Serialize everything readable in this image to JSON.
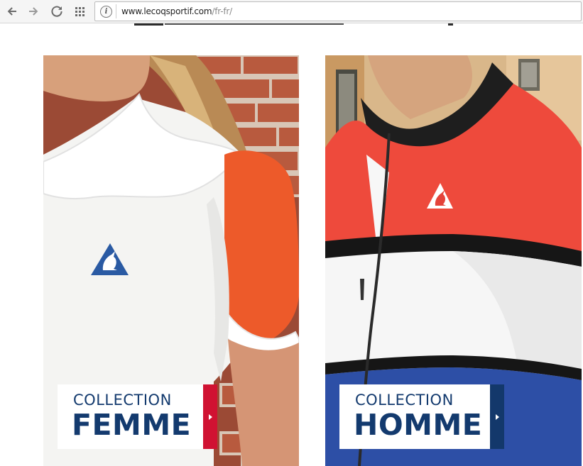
{
  "browser": {
    "url_host": "www.lecoqsportif.com",
    "url_path": "/fr-fr/"
  },
  "collections": [
    {
      "small": "COLLECTION",
      "big": "FEMME",
      "accent": "#d01232"
    },
    {
      "small": "COLLECTION",
      "big": "HOMME",
      "accent": "#13386b"
    }
  ],
  "colors": {
    "brand_blue": "#133a6e",
    "brand_red": "#d01232"
  },
  "icons": [
    "back-arrow-icon",
    "forward-arrow-icon",
    "reload-icon",
    "apps-grid-icon",
    "page-info-icon",
    "chevron-right-icon",
    "coq-logo-icon"
  ]
}
